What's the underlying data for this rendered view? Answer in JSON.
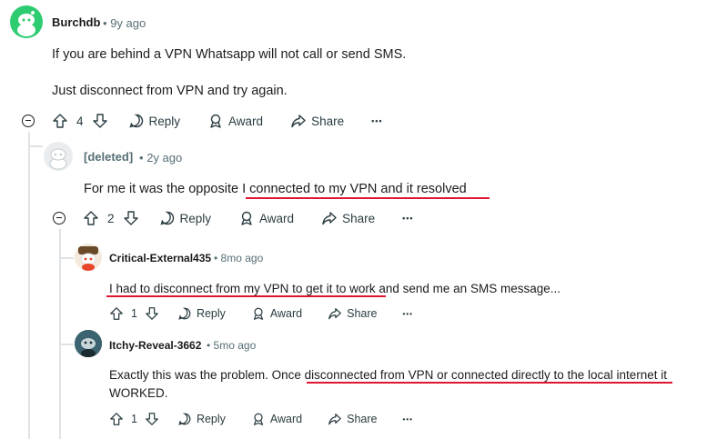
{
  "comments": [
    {
      "username": "Burchdb",
      "time": "9y ago",
      "lines": [
        "If you are behind a VPN Whatsapp will not call or send SMS.",
        "Just disconnect from VPN and try again."
      ],
      "votes": "4"
    },
    {
      "username": "[deleted]",
      "time": "2y ago",
      "lines": [
        "For me it was the opposite I connected to my VPN and it resolved"
      ],
      "votes": "2"
    },
    {
      "username": "Critical-External435",
      "time": "8mo ago",
      "lines": [
        "I had to disconnect from my VPN to get it to work and send me an SMS message..."
      ],
      "votes": "1"
    },
    {
      "username": "Itchy-Reveal-3662",
      "time": "5mo ago",
      "lines": [
        "Exactly this was the problem. Once disconnected from VPN or connected directly to the local internet it",
        "WORKED."
      ],
      "votes": "1"
    }
  ],
  "actions": {
    "reply": "Reply",
    "award": "Award",
    "share": "Share",
    "more": "•••"
  },
  "separator": "•",
  "colors": {
    "accent_red": "#e01530",
    "avatar_green": "#2ecc71",
    "thread_line": "#dfe3e5"
  }
}
